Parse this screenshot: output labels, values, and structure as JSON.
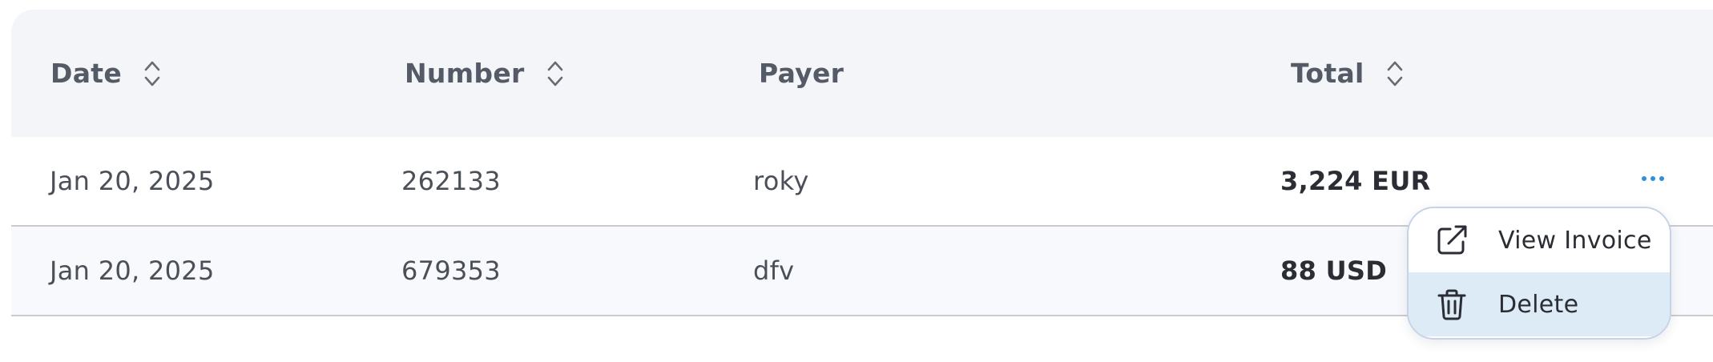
{
  "table": {
    "columns": [
      {
        "label": "Date",
        "sortable": true
      },
      {
        "label": "Number",
        "sortable": true
      },
      {
        "label": "Payer",
        "sortable": false
      },
      {
        "label": "Total",
        "sortable": true
      }
    ],
    "rows": [
      {
        "date": "Jan 20, 2025",
        "number": "262133",
        "payer": "roky",
        "total": "3,224 EUR"
      },
      {
        "date": "Jan 20, 2025",
        "number": "679353",
        "payer": "dfv",
        "total": "88 USD"
      }
    ]
  },
  "row_menu": {
    "items": [
      {
        "label": "View Invoice",
        "icon": "external-link-icon"
      },
      {
        "label": "Delete",
        "icon": "trash-icon"
      }
    ],
    "highlighted": "Delete"
  },
  "colors": {
    "header_bg": "#f4f5f9",
    "accent": "#2f8fd8",
    "menu_highlight": "#ddebf6"
  }
}
